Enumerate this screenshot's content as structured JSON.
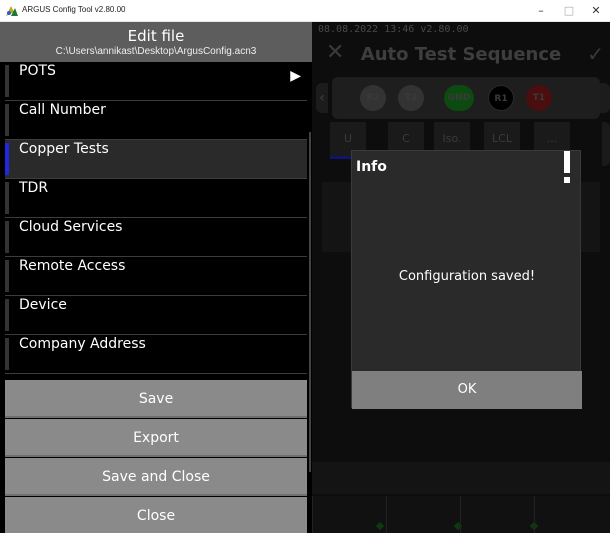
{
  "window": {
    "title": "ARGUS Config Tool v2.80.00",
    "minimize_glyph": "–",
    "maximize_glyph": "□",
    "close_glyph": "✕"
  },
  "editor": {
    "title": "Edit file",
    "path": "C:\\Users\\annikast\\Desktop\\ArgusConfig.acn3",
    "menu": [
      {
        "label": "POTS",
        "has_arrow": true
      },
      {
        "label": "Call Number"
      },
      {
        "label": "Copper Tests",
        "active": true
      },
      {
        "label": "TDR"
      },
      {
        "label": "Cloud Services"
      },
      {
        "label": "Remote Access"
      },
      {
        "label": "Device"
      },
      {
        "label": "Company Address"
      }
    ],
    "arrow_glyph": "▶",
    "buttons": {
      "save": "Save",
      "export": "Export",
      "save_close": "Save and Close",
      "close": "Close"
    }
  },
  "device": {
    "status": "08.08.2022 13:46   v2.80.00",
    "title": "Auto Test Sequence",
    "close_glyph": "✕",
    "check_glyph": "✓",
    "chips": [
      {
        "label": "R2",
        "color": "#3a3a3a"
      },
      {
        "label": "T2",
        "color": "#3a3a3a"
      },
      {
        "label": "GND",
        "color": "#0d5a12"
      },
      {
        "label": "R1",
        "color": "#000000"
      },
      {
        "label": "T1",
        "color": "#5a0f0f"
      }
    ],
    "tabs": [
      "U",
      "C",
      "Iso.",
      "LCL",
      "..."
    ]
  },
  "dialog": {
    "title": "Info",
    "message": "Configuration saved!",
    "ok_label": "OK"
  },
  "colors": {
    "accent": "#1f27e0",
    "header_bg": "#5d5d5d",
    "button_bg": "#8a8a8a"
  }
}
